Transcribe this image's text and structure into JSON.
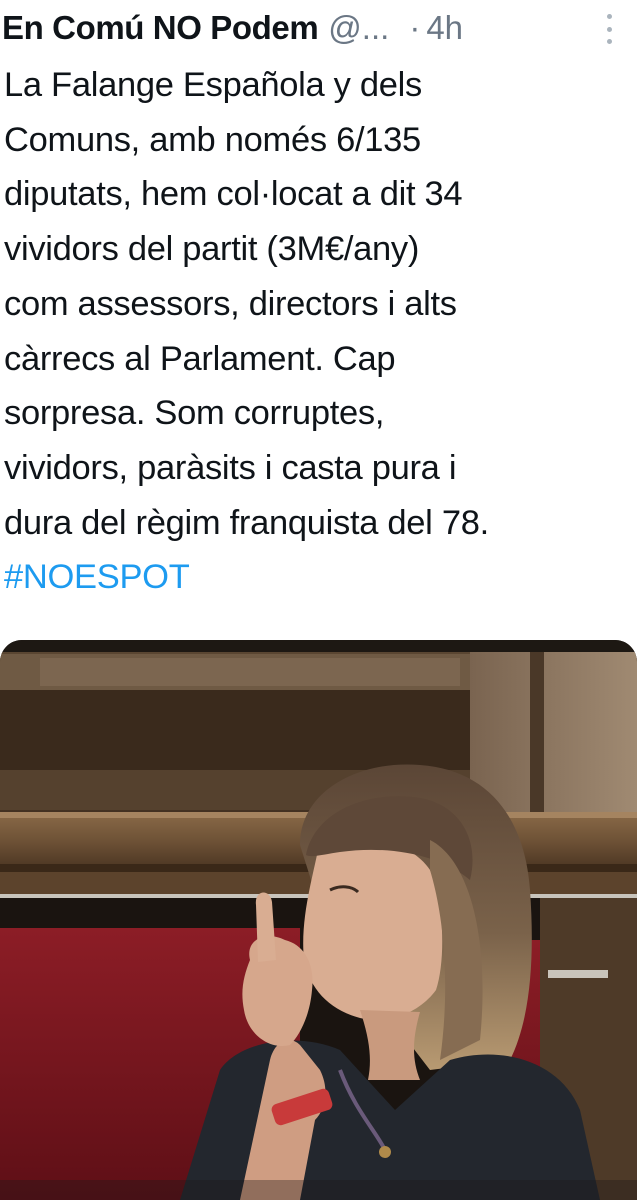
{
  "tweet": {
    "author_name": "En Comú NO Podem",
    "author_handle": "@...",
    "separator": "·",
    "timestamp": "4h",
    "body_lines": [
      "La Falange Española y dels",
      "Comuns, amb només 6/135",
      "diputats, hem col·locat a dit 34",
      "vividors del partit (3M€/any)",
      "com assessors, directors i alts",
      "càrrecs al Parlament. Cap",
      "sorpresa. Som corruptes,",
      "vividors, paràsits i casta pura i",
      "dura del règim franquista del 78."
    ],
    "hashtag": "#NOESPOT",
    "more_icon": "vertical-ellipsis-icon"
  },
  "colors": {
    "text": "#0f1419",
    "secondary": "#6b7785",
    "link": "#1d9bf0"
  }
}
